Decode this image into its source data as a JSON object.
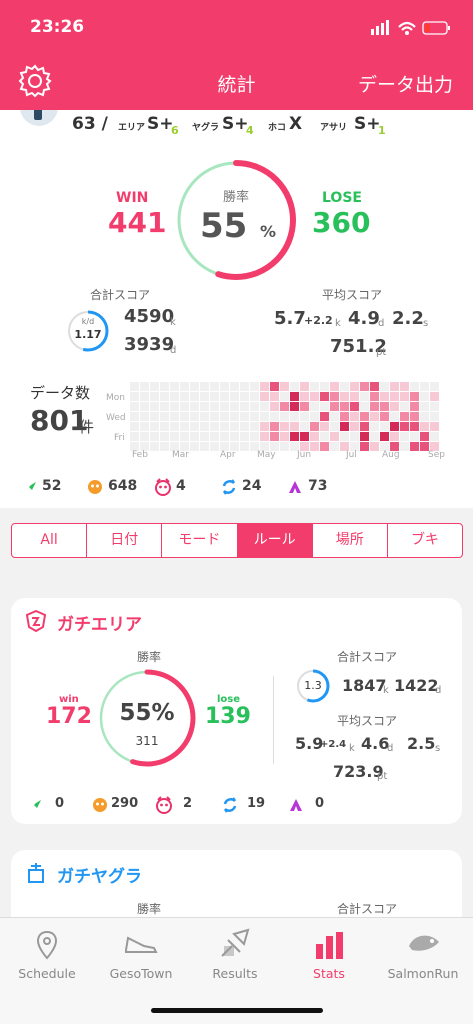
{
  "status": {
    "time": "23:26"
  },
  "header": {
    "title": "統計",
    "export_label": "データ出力"
  },
  "ranks": {
    "level": "63 /",
    "items": [
      {
        "label": "エリア",
        "rank": "S+",
        "sub": "6"
      },
      {
        "label": "ヤグラ",
        "rank": "S+",
        "sub": "4"
      },
      {
        "label": "ホコ",
        "rank": "X",
        "sub": ""
      },
      {
        "label": "アサリ",
        "rank": "S+",
        "sub": "1"
      }
    ]
  },
  "summary": {
    "win_label": "WIN",
    "win": "441",
    "lose_label": "LOSE",
    "lose": "360",
    "rate_label": "勝率",
    "rate": "55",
    "rate_unit": "%",
    "win_rate": 0.55,
    "total_score_label": "合計スコア",
    "kd_label": "k/d",
    "kd": "1.17",
    "kd_fill": 0.54,
    "kills": "4590",
    "kills_unit": "k",
    "deaths": "3939",
    "deaths_unit": "d",
    "avg_score_label": "平均スコア",
    "avg_k": "5.7",
    "avg_assist": "+2.2",
    "avg_k_unit": "k",
    "avg_d": "4.9",
    "avg_d_unit": "d",
    "avg_s": "2.2",
    "avg_s_unit": "s",
    "avg_pt": "751.2",
    "avg_pt_unit": "pt"
  },
  "data_count": {
    "label": "データ数",
    "value": "801",
    "unit": "件"
  },
  "heatmap": {
    "days": [
      "Mon",
      "Wed",
      "Fri"
    ],
    "months": [
      "Feb",
      "Mar",
      "Apr",
      "May",
      "Jun",
      "Jul",
      "Aug",
      "Sep"
    ]
  },
  "modes_summary": [
    {
      "icon": "turf-war-icon",
      "value": "52"
    },
    {
      "icon": "salmon-run-icon",
      "value": "648"
    },
    {
      "icon": "rainmaker-icon",
      "value": "4"
    },
    {
      "icon": "clam-blitz-icon",
      "value": "24"
    },
    {
      "icon": "tower-control-icon",
      "value": "73"
    }
  ],
  "tabs": [
    {
      "label": "All",
      "active": false
    },
    {
      "label": "日付",
      "active": false
    },
    {
      "label": "モード",
      "active": false
    },
    {
      "label": "ルール",
      "active": true
    },
    {
      "label": "場所",
      "active": false
    },
    {
      "label": "ブキ",
      "active": false
    }
  ],
  "area_card": {
    "title": "ガチエリア",
    "rate_label": "勝率",
    "win_label": "win",
    "win": "172",
    "lose_label": "lose",
    "lose": "139",
    "rate": "55%",
    "total": "311",
    "win_rate": 0.55,
    "total_score_label": "合計スコア",
    "kd": "1.3",
    "kd_fill": 0.56,
    "kills": "1847",
    "kills_unit": "k",
    "deaths": "1422",
    "deaths_unit": "d",
    "avg_score_label": "平均スコア",
    "avg_k": "5.9",
    "avg_assist": "+2.4",
    "avg_k_unit": "k",
    "avg_d": "4.6",
    "avg_d_unit": "d",
    "avg_s": "2.5",
    "avg_s_unit": "s",
    "avg_pt": "723.9",
    "avg_pt_unit": "pt",
    "modes": [
      {
        "icon": "turf-war-icon",
        "value": "0"
      },
      {
        "icon": "salmon-run-icon",
        "value": "290"
      },
      {
        "icon": "rainmaker-icon",
        "value": "2"
      },
      {
        "icon": "clam-blitz-icon",
        "value": "19"
      },
      {
        "icon": "tower-control-icon",
        "value": "0"
      }
    ]
  },
  "yagura_card": {
    "title": "ガチヤグラ",
    "rate_label": "勝率",
    "total_score_label": "合計スコア"
  },
  "tabbar": [
    {
      "label": "Schedule",
      "icon": "map-pin-icon",
      "active": false
    },
    {
      "label": "GesoTown",
      "icon": "shoe-icon",
      "active": false
    },
    {
      "label": "Results",
      "icon": "weapons-icon",
      "active": false
    },
    {
      "label": "Stats",
      "icon": "bar-chart-icon",
      "active": true
    },
    {
      "label": "SalmonRun",
      "icon": "salmon-icon",
      "active": false
    }
  ],
  "colors": {
    "accent": "#f23d6c",
    "green": "#27c05a",
    "blue": "#2196f3"
  }
}
